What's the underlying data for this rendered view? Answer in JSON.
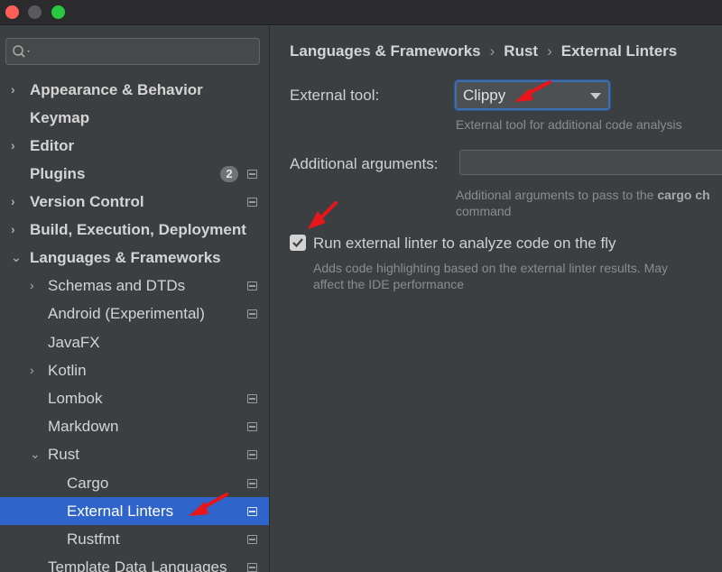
{
  "window": {
    "controls": [
      "close",
      "minimize",
      "maximize"
    ]
  },
  "search": {
    "icon": "search-icon",
    "placeholder": ""
  },
  "sidebar": {
    "items": [
      {
        "label": "Appearance & Behavior",
        "chevron": "›"
      },
      {
        "label": "Keymap"
      },
      {
        "label": "Editor",
        "chevron": "›"
      },
      {
        "label": "Plugins",
        "badge": "2"
      },
      {
        "label": "Version Control",
        "chevron": "›"
      },
      {
        "label": "Build, Execution, Deployment",
        "chevron": "›"
      },
      {
        "label": "Languages & Frameworks",
        "chevron": "⌄"
      },
      {
        "label": "Schemas and DTDs",
        "chevron": "›"
      },
      {
        "label": "Android (Experimental)"
      },
      {
        "label": "JavaFX"
      },
      {
        "label": "Kotlin",
        "chevron": "›"
      },
      {
        "label": "Lombok"
      },
      {
        "label": "Markdown"
      },
      {
        "label": "Rust",
        "chevron": "⌄"
      },
      {
        "label": "Cargo"
      },
      {
        "label": "External Linters",
        "selected": true
      },
      {
        "label": "Rustfmt"
      },
      {
        "label": "Template Data Languages"
      }
    ]
  },
  "breadcrumb": [
    "Languages & Frameworks",
    "Rust",
    "External Linters"
  ],
  "breadcrumb_separator": "›",
  "form": {
    "external_tool_label": "External tool:",
    "external_tool_value": "Clippy",
    "external_tool_help": "External tool for additional code analysis",
    "additional_args_label": "Additional arguments:",
    "additional_args_value": "",
    "additional_args_help_prefix": "Additional arguments to pass to the ",
    "additional_args_help_bold": "cargo ch",
    "additional_args_help_line2": "command",
    "run_linter_label": "Run external linter to analyze code on the fly",
    "run_linter_checked": true,
    "run_linter_help_line1": "Adds code highlighting based on the external linter results. May",
    "run_linter_help_line2": "affect the IDE performance"
  },
  "colors": {
    "selection": "#2f65ca",
    "annotation_arrow": "#e8161a",
    "focus_ring": "#3d6fb0"
  }
}
